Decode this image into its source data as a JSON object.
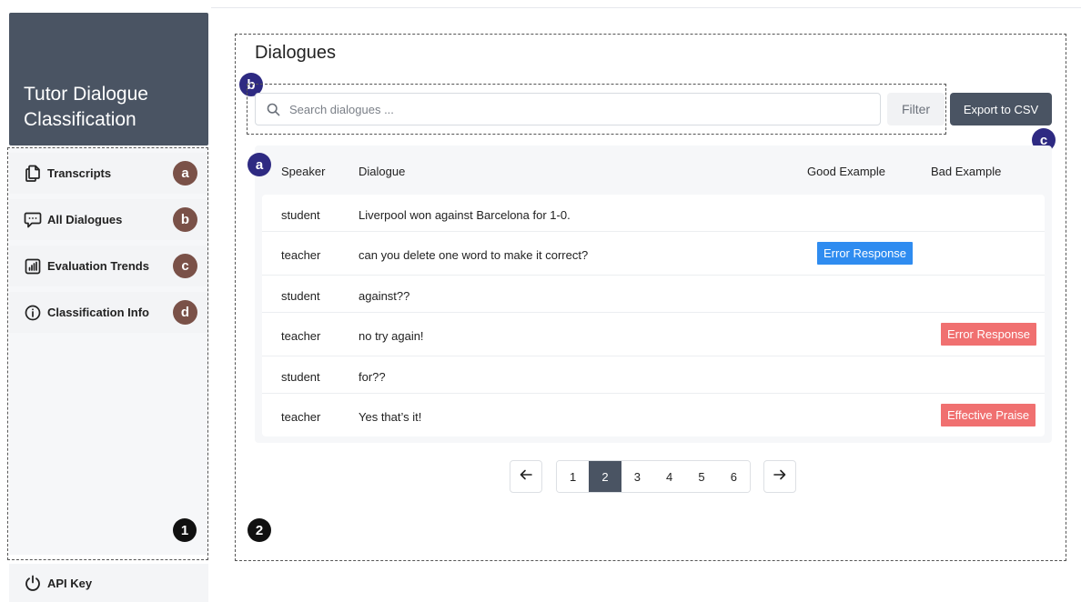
{
  "app": {
    "title": "Tutor Dialogue Classification"
  },
  "sidebar": {
    "items": [
      {
        "label": "Transcripts",
        "badge": "a",
        "icon": "documents-icon"
      },
      {
        "label": "All Dialogues",
        "badge": "b",
        "icon": "chat-bubble-icon"
      },
      {
        "label": "Evaluation Trends",
        "badge": "c",
        "icon": "bar-chart-icon"
      },
      {
        "label": "Classification Info",
        "badge": "d",
        "icon": "info-icon"
      }
    ],
    "footer": {
      "label": "API Key",
      "icon": "power-icon"
    },
    "marker": "1"
  },
  "main": {
    "title": "Dialogues",
    "marker": "2",
    "search": {
      "placeholder": "Search dialogues ...",
      "value": "",
      "badge": "b"
    },
    "filter_label": "Filter",
    "export_label": "Export to CSV",
    "export_badge": "c",
    "table_badge": "a",
    "columns": [
      "Speaker",
      "Dialogue",
      "Good Example",
      "Bad Example"
    ],
    "rows": [
      {
        "speaker": "student",
        "dialogue": "Liverpool won against Barcelona for 1-0.",
        "good": "",
        "bad": ""
      },
      {
        "speaker": "teacher",
        "dialogue": "can you delete one word to make it correct?",
        "good": "Error Response",
        "bad": ""
      },
      {
        "speaker": "student",
        "dialogue": "against??",
        "good": "",
        "bad": ""
      },
      {
        "speaker": "teacher",
        "dialogue": "no try again!",
        "good": "",
        "bad": "Error Response"
      },
      {
        "speaker": "student",
        "dialogue": "for??",
        "good": "",
        "bad": ""
      },
      {
        "speaker": "teacher",
        "dialogue": "Yes that’s it!",
        "good": "",
        "bad": "Effective Praise"
      }
    ],
    "pagination": {
      "pages": [
        "1",
        "2",
        "3",
        "4",
        "5",
        "6"
      ],
      "current": "2",
      "prev_icon": "arrow-left-icon",
      "next_icon": "arrow-right-icon"
    }
  },
  "colors": {
    "brand": "#4a5463",
    "good_tag": "#2f8cf0",
    "bad_tag": "#f07070",
    "nav_badge": "#7a5148",
    "callout_badge": "#2e2a82"
  }
}
